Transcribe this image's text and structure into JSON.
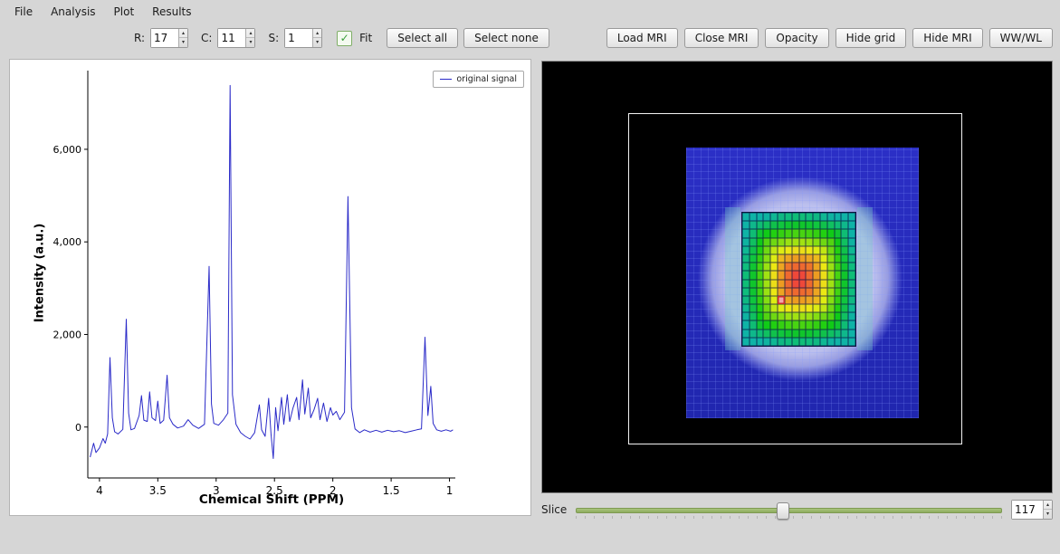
{
  "menu": {
    "items": [
      "File",
      "Analysis",
      "Plot",
      "Results"
    ]
  },
  "toolbar": {
    "r_label": "R:",
    "r_value": "17",
    "c_label": "C:",
    "c_value": "11",
    "s_label": "S:",
    "s_value": "1",
    "fit_label": "Fit",
    "check_icon": "✓",
    "up_icon": "▴",
    "down_icon": "▾",
    "select_all_label": "Select all",
    "select_none_label": "Select none",
    "right_buttons": [
      "Load MRI",
      "Close MRI",
      "Opacity",
      "Hide grid",
      "Hide MRI",
      "WW/WL"
    ]
  },
  "chart_data": {
    "type": "line",
    "title": "",
    "xlabel": "Chemical Shift (PPM)",
    "ylabel": "Intensity (a.u.)",
    "xlim": [
      4.1,
      0.95
    ],
    "ylim": [
      -1100,
      7700
    ],
    "grid": false,
    "x_ticks": [
      {
        "v": 4,
        "label": "4"
      },
      {
        "v": 3.5,
        "label": "3.5"
      },
      {
        "v": 3,
        "label": "3"
      },
      {
        "v": 2.5,
        "label": "2.5"
      },
      {
        "v": 2,
        "label": "2"
      },
      {
        "v": 1.5,
        "label": "1.5"
      },
      {
        "v": 1,
        "label": "1"
      }
    ],
    "y_ticks": [
      {
        "v": 0,
        "label": "0"
      },
      {
        "v": 2000,
        "label": "2,000"
      },
      {
        "v": 4000,
        "label": "4,000"
      },
      {
        "v": 6000,
        "label": "6,000"
      }
    ],
    "legend": {
      "position": "top-right",
      "entries": [
        "original signal"
      ]
    },
    "series": [
      {
        "name": "original signal",
        "color": "#2a2ac8",
        "points": [
          [
            4.08,
            -650
          ],
          [
            4.05,
            -350
          ],
          [
            4.03,
            -550
          ],
          [
            4.0,
            -450
          ],
          [
            3.97,
            -250
          ],
          [
            3.95,
            -350
          ],
          [
            3.93,
            -150
          ],
          [
            3.91,
            1500
          ],
          [
            3.89,
            200
          ],
          [
            3.87,
            -100
          ],
          [
            3.84,
            -150
          ],
          [
            3.8,
            -50
          ],
          [
            3.77,
            2330
          ],
          [
            3.75,
            300
          ],
          [
            3.73,
            -60
          ],
          [
            3.7,
            -30
          ],
          [
            3.66,
            250
          ],
          [
            3.64,
            680
          ],
          [
            3.62,
            150
          ],
          [
            3.59,
            120
          ],
          [
            3.57,
            760
          ],
          [
            3.55,
            200
          ],
          [
            3.52,
            140
          ],
          [
            3.5,
            560
          ],
          [
            3.48,
            80
          ],
          [
            3.45,
            150
          ],
          [
            3.42,
            1120
          ],
          [
            3.4,
            200
          ],
          [
            3.37,
            60
          ],
          [
            3.33,
            -20
          ],
          [
            3.28,
            20
          ],
          [
            3.24,
            160
          ],
          [
            3.2,
            40
          ],
          [
            3.15,
            -30
          ],
          [
            3.1,
            60
          ],
          [
            3.06,
            3470
          ],
          [
            3.04,
            500
          ],
          [
            3.02,
            80
          ],
          [
            2.98,
            40
          ],
          [
            2.94,
            150
          ],
          [
            2.9,
            300
          ],
          [
            2.88,
            7380
          ],
          [
            2.86,
            700
          ],
          [
            2.83,
            60
          ],
          [
            2.79,
            -120
          ],
          [
            2.75,
            -200
          ],
          [
            2.71,
            -260
          ],
          [
            2.67,
            -120
          ],
          [
            2.63,
            480
          ],
          [
            2.61,
            -60
          ],
          [
            2.58,
            -200
          ],
          [
            2.55,
            620
          ],
          [
            2.53,
            -150
          ],
          [
            2.51,
            -680
          ],
          [
            2.49,
            420
          ],
          [
            2.47,
            -80
          ],
          [
            2.44,
            640
          ],
          [
            2.42,
            60
          ],
          [
            2.39,
            700
          ],
          [
            2.37,
            120
          ],
          [
            2.34,
            420
          ],
          [
            2.31,
            640
          ],
          [
            2.29,
            160
          ],
          [
            2.26,
            1020
          ],
          [
            2.24,
            280
          ],
          [
            2.21,
            840
          ],
          [
            2.19,
            200
          ],
          [
            2.16,
            380
          ],
          [
            2.13,
            620
          ],
          [
            2.11,
            160
          ],
          [
            2.08,
            520
          ],
          [
            2.05,
            120
          ],
          [
            2.02,
            420
          ],
          [
            2.0,
            260
          ],
          [
            1.97,
            340
          ],
          [
            1.94,
            160
          ],
          [
            1.9,
            320
          ],
          [
            1.87,
            4980
          ],
          [
            1.84,
            420
          ],
          [
            1.81,
            -40
          ],
          [
            1.77,
            -120
          ],
          [
            1.73,
            -60
          ],
          [
            1.68,
            -110
          ],
          [
            1.63,
            -70
          ],
          [
            1.58,
            -110
          ],
          [
            1.53,
            -70
          ],
          [
            1.48,
            -100
          ],
          [
            1.43,
            -80
          ],
          [
            1.38,
            -120
          ],
          [
            1.33,
            -90
          ],
          [
            1.28,
            -60
          ],
          [
            1.24,
            -40
          ],
          [
            1.21,
            1940
          ],
          [
            1.185,
            250
          ],
          [
            1.16,
            880
          ],
          [
            1.14,
            80
          ],
          [
            1.11,
            -60
          ],
          [
            1.07,
            -90
          ],
          [
            1.03,
            -60
          ],
          [
            0.99,
            -90
          ],
          [
            0.97,
            -60
          ]
        ]
      }
    ]
  },
  "mri": {
    "slice_label": "Slice",
    "slice_value": "117",
    "grid": {
      "rows": 16,
      "cols": 16,
      "selected": {
        "row": 10,
        "col": 5
      }
    },
    "colors": {
      "selected_fill": "#f2a6ac",
      "selected_border": "#cc2a2a",
      "field_blue": "#2b2fc6",
      "phantom_lavender": "#aab0e2"
    }
  }
}
